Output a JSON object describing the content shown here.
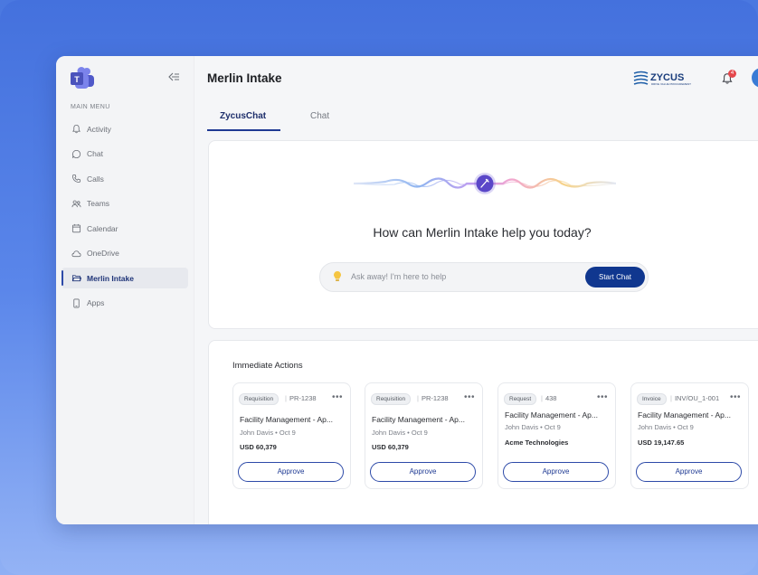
{
  "sidebar": {
    "menu_title": "MAIN MENU",
    "items": [
      {
        "label": "Activity",
        "icon": "bell-icon"
      },
      {
        "label": "Chat",
        "icon": "chat-bubble-icon"
      },
      {
        "label": "Calls",
        "icon": "phone-icon"
      },
      {
        "label": "Teams",
        "icon": "people-icon"
      },
      {
        "label": "Calendar",
        "icon": "calendar-icon"
      },
      {
        "label": "OneDrive",
        "icon": "cloud-icon"
      },
      {
        "label": "Merlin Intake",
        "icon": "folder-icon",
        "active": true
      },
      {
        "label": "Apps",
        "icon": "device-icon"
      }
    ]
  },
  "header": {
    "title": "Merlin Intake",
    "brand": "ZYCUS",
    "brand_tagline": "DRIVE VALUE PROCUREMENT",
    "notification_count": "4"
  },
  "tabs": [
    {
      "label": "ZycusChat",
      "active": true
    },
    {
      "label": "Chat",
      "active": false
    }
  ],
  "chat": {
    "headline": "How can Merlin Intake help you today?",
    "placeholder": "Ask away! I'm here to help",
    "start_label": "Start Chat"
  },
  "actions": {
    "title": "Immediate Actions",
    "cards": [
      {
        "type": "Requisition",
        "id": "PR-1238",
        "title": "Facility Management - Ap...",
        "meta": "John Davis • Oct 9",
        "amount": "USD 60,379",
        "button": "Approve"
      },
      {
        "type": "Requisition",
        "id": "PR-1238",
        "title": "Facility Management - Ap...",
        "meta": "John Davis • Oct 9",
        "amount": "USD 60,379",
        "button": "Approve"
      },
      {
        "type": "Request",
        "id": "438",
        "title": "Facility Management - Ap...",
        "meta": "John Davis • Oct 9",
        "amount": "Acme Technologies",
        "button": "Approve"
      },
      {
        "type": "Invoice",
        "id": "INV/OU_1-001",
        "title": "Facility Management - Ap...",
        "meta": "John Davis • Oct 9",
        "amount": "USD 19,147.65",
        "button": "Approve"
      }
    ]
  },
  "colors": {
    "accent": "#10378f",
    "active_nav": "#1f3478",
    "badge_red": "#e5484d"
  }
}
